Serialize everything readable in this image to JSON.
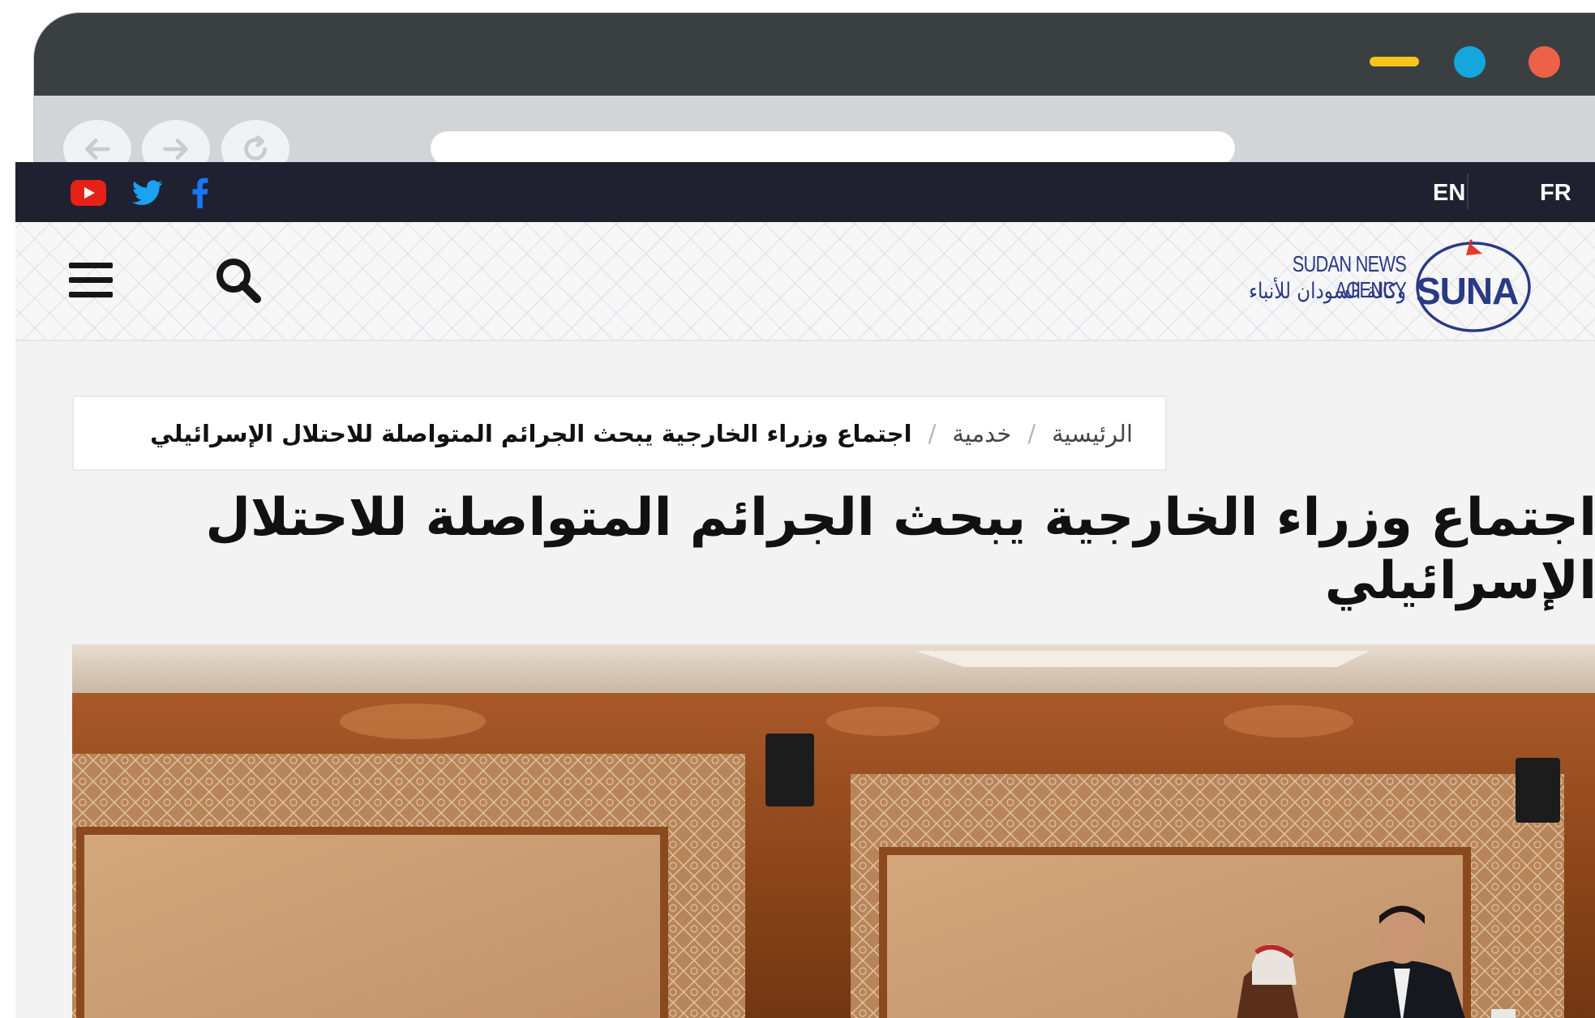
{
  "browser": {
    "nav_icons": [
      "back-arrow-icon",
      "forward-arrow-icon",
      "reload-icon"
    ],
    "window_controls": [
      "minimize",
      "maximize",
      "close"
    ],
    "colors": {
      "minimize": "#f6c519",
      "maximize": "#15a6dd",
      "close": "#ee6149"
    }
  },
  "topbar": {
    "social_icons": [
      "youtube-icon",
      "twitter-icon",
      "facebook-icon"
    ],
    "languages": {
      "en": "EN",
      "fr": "FR"
    },
    "background": "#1f2130"
  },
  "header": {
    "logo": {
      "english": "SUDAN NEWS AGENCY",
      "arabic": "وكالة السودان للأنباء",
      "wordmark": "SUNA",
      "color": "#2a3a84"
    },
    "icons": [
      "hamburger-menu-icon",
      "search-icon"
    ]
  },
  "breadcrumb": {
    "home": "الرئيسية",
    "section": "خدمية",
    "separator": "/",
    "current": "اجتماع وزراء الخارجية يبحث الجرائم المتواصلة للاحتلال الإسرائيلي"
  },
  "article": {
    "title_line1": "اجتماع وزراء الخارجية يبحث الجرائم المتواصلة للاحتلال",
    "title_line2": "الإسرائيلي"
  }
}
